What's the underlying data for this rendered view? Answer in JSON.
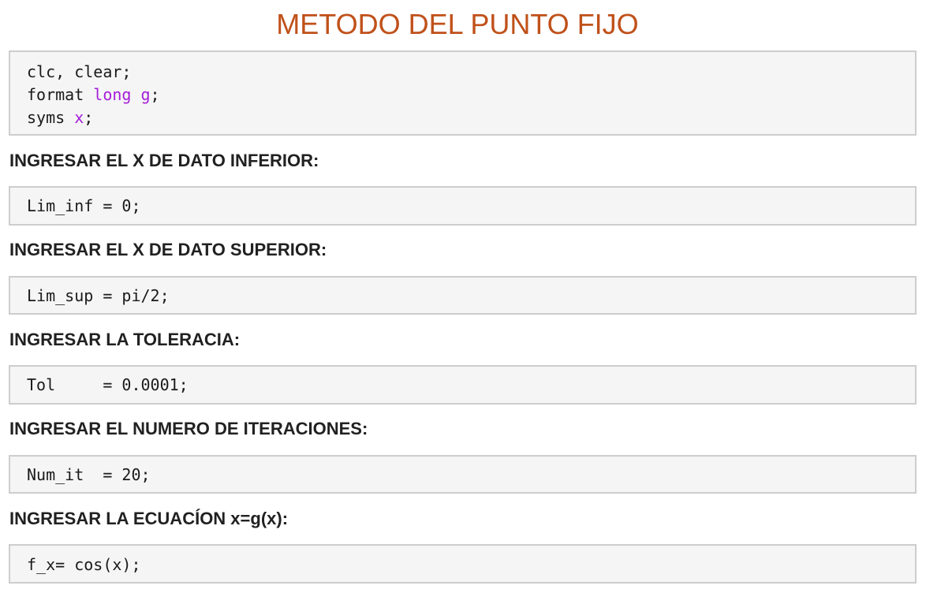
{
  "title": "METODO DEL PUNTO FIJO",
  "init_code": {
    "line1": "clc, clear;",
    "line2_prefix": "format ",
    "line2_arg": "long g",
    "line2_suffix": ";",
    "line3_prefix": "syms ",
    "line3_arg": "x",
    "line3_suffix": ";"
  },
  "sections": [
    {
      "heading": "INGRESAR EL X DE DATO INFERIOR:",
      "code": "Lim_inf = 0;"
    },
    {
      "heading": "INGRESAR EL X DE DATO SUPERIOR:",
      "code": "Lim_sup = pi/2;"
    },
    {
      "heading": "INGRESAR LA TOLERACIA:",
      "code": "Tol     = 0.0001;"
    },
    {
      "heading": "INGRESAR EL NUMERO DE ITERACIONES:",
      "code": "Num_it  = 20;"
    },
    {
      "heading": "INGRESAR LA ECUACÍON x=g(x):",
      "code": "f_x= cos(x);"
    }
  ],
  "colors": {
    "title": "#c0511a",
    "keyword": "#a51fd9",
    "code_background": "#f5f5f5",
    "code_border": "#cdcdcd"
  }
}
